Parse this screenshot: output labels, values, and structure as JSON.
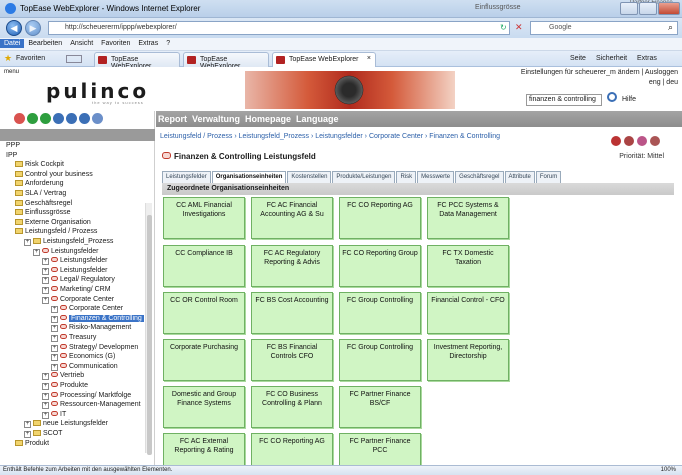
{
  "window": {
    "title": "TopEase WebExplorer - Windows Internet Explorer",
    "bg_title_right": "Partner Finance",
    "bg_tab_label": "Einflussgrösse"
  },
  "address": {
    "url": "http://scheuererm/ippp/webexplorer/",
    "search_placeholder": "Google"
  },
  "menu": {
    "items": [
      "Datei",
      "Bearbeiten",
      "Ansicht",
      "Favoriten",
      "Extras",
      "?"
    ]
  },
  "favbar": {
    "favorites": "Favoriten",
    "tabs": [
      "TopEase WebExplorer",
      "TopEase WebExplorer",
      "TopEase WebExplorer"
    ],
    "tools": [
      "Seite",
      "Sicherheit",
      "Extras"
    ]
  },
  "header": {
    "menu_link": "menu",
    "logo": "pulinco",
    "tagline": "the way to success",
    "settings": "Einstellungen für scheuerer_m ändern | Ausloggen",
    "lang": "eng | deu",
    "search_value": "finanzen & controlling",
    "help": "Hilfe"
  },
  "main_nav": [
    "Report",
    "Verwaltung",
    "Homepage",
    "Language"
  ],
  "breadcrumb": "Leistungsfeld / Prozess › Leistungsfeld_Prozess › Leistungsfelder › Corporate Center › Finanzen & Controlling",
  "page_title": "Finanzen & Controlling Leistungsfeld",
  "priority": "Priorität: Mittel",
  "subtabs": [
    "Leistungsfelder",
    "Organisationseinheiten",
    "Kostenstellen",
    "Produkte/Leistungen",
    "Risk",
    "Messwerte",
    "Geschäftsregel",
    "Attribute",
    "Forum"
  ],
  "active_subtab": "Organisationseinheiten",
  "section_title": "Zugeordnete Organisationseinheiten",
  "org_cells": [
    [
      "CC AML Financial Investigations",
      "FC AC Financial Accounting AG & Su",
      "FC CO Reporting AG",
      "FC PCC Systems & Data Management"
    ],
    [
      "CC Compliance IB",
      "FC AC Regulatory Reporting & Advis",
      "FC CO Reporting Group",
      "FC TX Domestic Taxation"
    ],
    [
      "CC OR Control Room",
      "FC BS Cost Accounting",
      "FC Group Controlling",
      "Financial Control - CFO"
    ],
    [
      "Corporate Purchasing",
      "FC BS Financial Controls CFO",
      "FC Group Controlling",
      "Investment Reporting, Directorship"
    ],
    [
      "Domestic and Group Finance Systems",
      "FC CO Business Controlling & Plann",
      "FC Partner Finance BS/CF",
      ""
    ],
    [
      "FC AC External Reporting & Rating",
      "FC CO Reporting AG",
      "FC Partner Finance PCC",
      ""
    ]
  ],
  "tree": [
    {
      "t": "PPP",
      "i": 0,
      "ic": "none"
    },
    {
      "t": "IPP",
      "i": 0,
      "ic": "none"
    },
    {
      "t": "Risk Cockpit",
      "i": 1,
      "ic": "fold"
    },
    {
      "t": "Control your business",
      "i": 1,
      "ic": "fold"
    },
    {
      "t": "Anforderung",
      "i": 1,
      "ic": "fold"
    },
    {
      "t": "SLA / Vertrag",
      "i": 1,
      "ic": "fold"
    },
    {
      "t": "Geschäftsregel",
      "i": 1,
      "ic": "fold"
    },
    {
      "t": "Einflussgrösse",
      "i": 1,
      "ic": "fold"
    },
    {
      "t": "Externe Organisation",
      "i": 1,
      "ic": "fold"
    },
    {
      "t": "Leistungsfeld / Prozess",
      "i": 1,
      "ic": "fold"
    },
    {
      "t": "Leistungsfeld_Prozess",
      "i": 2,
      "ic": "fold"
    },
    {
      "t": "Leistungsfelder",
      "i": 3,
      "ic": "red"
    },
    {
      "t": "Leistungsfelder",
      "i": 4,
      "ic": "red"
    },
    {
      "t": "Leistungsfelder",
      "i": 4,
      "ic": "red"
    },
    {
      "t": "Legal/ Regulatory",
      "i": 4,
      "ic": "red"
    },
    {
      "t": "Marketing/ CRM",
      "i": 4,
      "ic": "red"
    },
    {
      "t": "Corporate Center",
      "i": 4,
      "ic": "red"
    },
    {
      "t": "Corporate Center",
      "i": 5,
      "ic": "red"
    },
    {
      "t": "Finanzen & Controlling",
      "i": 5,
      "ic": "red",
      "sel": true
    },
    {
      "t": "Risiko-Management",
      "i": 5,
      "ic": "red"
    },
    {
      "t": "Treasury",
      "i": 5,
      "ic": "red"
    },
    {
      "t": "Strategy/ Developmen",
      "i": 5,
      "ic": "red"
    },
    {
      "t": "Economics (G)",
      "i": 5,
      "ic": "red"
    },
    {
      "t": "Communication",
      "i": 5,
      "ic": "red"
    },
    {
      "t": "Vertrieb",
      "i": 4,
      "ic": "red"
    },
    {
      "t": "Produkte",
      "i": 4,
      "ic": "red"
    },
    {
      "t": "Processing/ Marktfolge",
      "i": 4,
      "ic": "red"
    },
    {
      "t": "Ressourcen-Management",
      "i": 4,
      "ic": "red"
    },
    {
      "t": "IT",
      "i": 4,
      "ic": "red"
    },
    {
      "t": "neue Leistungsfelder",
      "i": 2,
      "ic": "fold"
    },
    {
      "t": "SCOT",
      "i": 2,
      "ic": "fold"
    },
    {
      "t": "Produkt",
      "i": 1,
      "ic": "fold"
    }
  ],
  "status": {
    "text": "Enthält Befehle zum Arbeiten mit den ausgewählten Elementen.",
    "zoom": "100%"
  },
  "colors": {
    "cell_fill": "#d0f5c4",
    "cell_border": "#6fb163",
    "nav_gray": "#9a9a9a",
    "link": "#2b5fa8",
    "selection": "#3a73c7"
  }
}
